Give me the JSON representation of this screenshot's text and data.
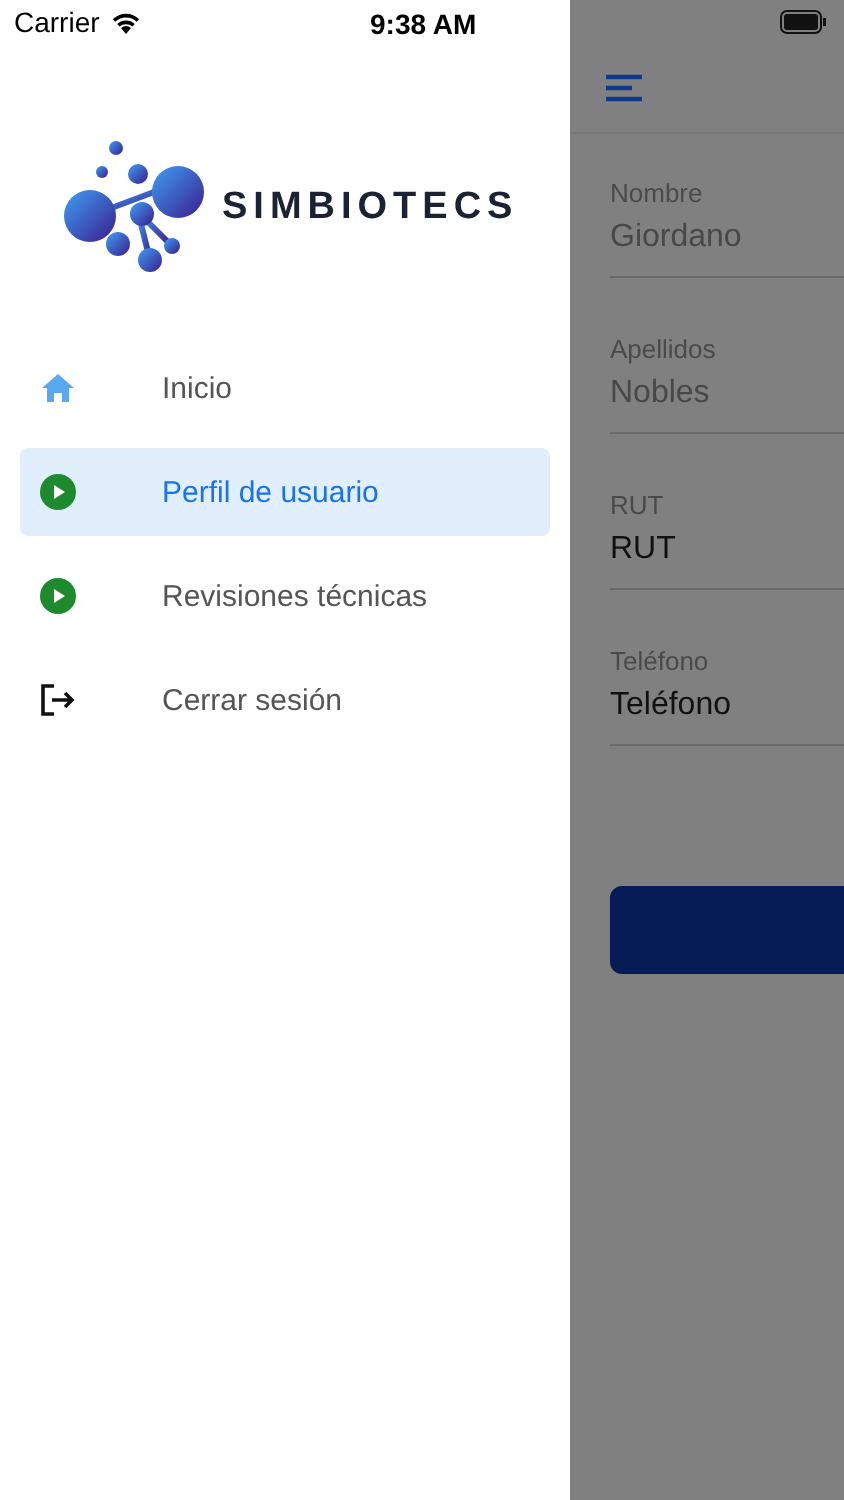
{
  "status_bar": {
    "carrier": "Carrier",
    "time": "9:38 AM"
  },
  "drawer": {
    "brand": "SIMBIOTECS",
    "items": [
      {
        "label": "Inicio",
        "kind": "home",
        "selected": false
      },
      {
        "label": "Perfil de usuario",
        "kind": "play",
        "selected": true
      },
      {
        "label": "Revisiones técnicas",
        "kind": "play",
        "selected": false
      },
      {
        "label": "Cerrar sesión",
        "kind": "logout",
        "selected": false
      }
    ]
  },
  "form": {
    "fields": [
      {
        "label": "Nombre",
        "value": "Giordano",
        "disabled": true
      },
      {
        "label": "Apellidos",
        "value": "Nobles",
        "disabled": true
      },
      {
        "label": "RUT",
        "value": "RUT",
        "disabled": false
      },
      {
        "label": "Teléfono",
        "value": "Teléfono",
        "disabled": false
      }
    ]
  }
}
